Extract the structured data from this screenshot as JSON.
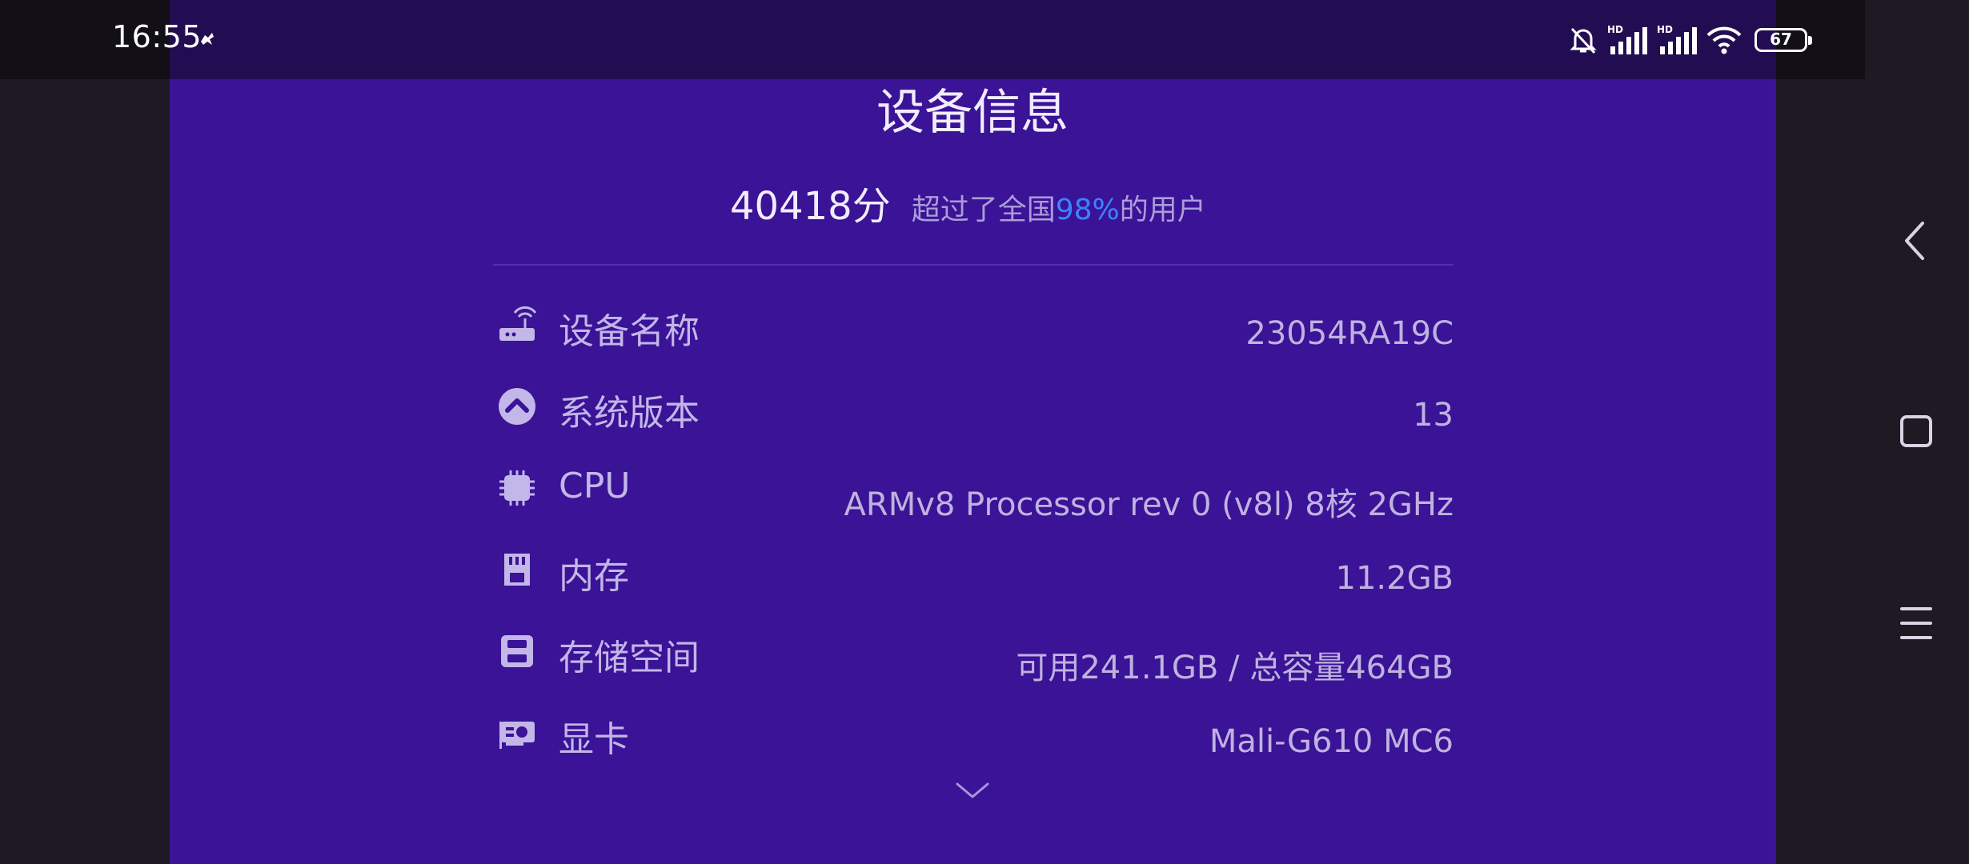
{
  "status_bar": {
    "time": "16:55",
    "battery": "67",
    "icons": [
      "notification-app-icon",
      "mute-bell-icon",
      "signal-hd-icon",
      "signal-hd-icon",
      "wifi-icon",
      "battery-icon"
    ]
  },
  "page": {
    "title": "设备信息",
    "score": "40418分",
    "score_text_before": "超过了全国",
    "score_percent": "98%",
    "score_text_after": "的用户"
  },
  "rows": [
    {
      "icon": "router-icon",
      "label": "设备名称",
      "value": "23054RA19C"
    },
    {
      "icon": "system-version-icon",
      "label": "系统版本",
      "value": "13"
    },
    {
      "icon": "cpu-chip-icon",
      "label": "CPU",
      "value": "ARMv8 Processor rev 0 (v8l) 8核 2GHz"
    },
    {
      "icon": "memory-card-icon",
      "label": "内存",
      "value": "11.2GB"
    },
    {
      "icon": "storage-save-icon",
      "label": "存储空间",
      "value": "可用241.1GB / 总容量464GB"
    },
    {
      "icon": "graphics-card-icon",
      "label": "显卡",
      "value": "Mali-G610 MC6"
    }
  ],
  "navigation": [
    "back-icon",
    "home-square-icon",
    "menu-lines-icon"
  ],
  "colors": {
    "panel_bg": "#3a1396",
    "status_bar_bg": "#230d52",
    "side_bg": "#1e1a24",
    "accent": "#3d84ff",
    "text": "#bfb2e0"
  }
}
